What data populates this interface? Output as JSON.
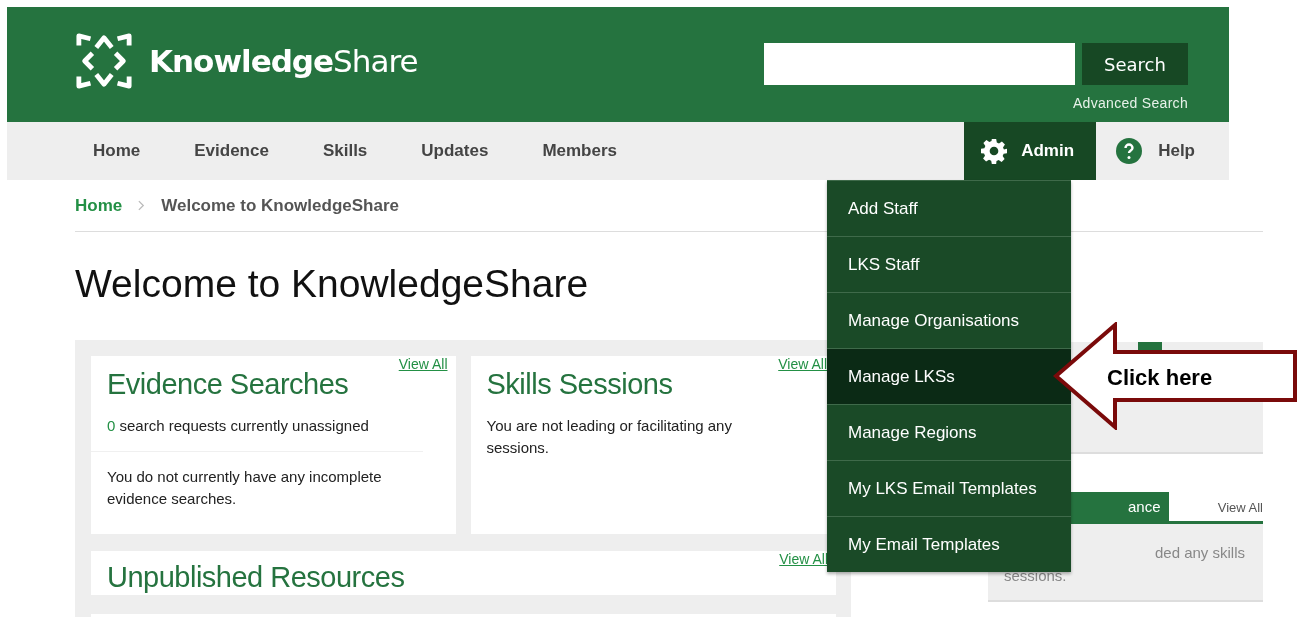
{
  "header": {
    "logo": {
      "bold": "Knowledge",
      "light": "Share"
    },
    "search": {
      "button": "Search",
      "link": "Advanced Search"
    }
  },
  "nav": {
    "items": [
      {
        "label": "Home",
        "kind": "plain",
        "selected": false
      },
      {
        "label": "Evidence",
        "kind": "plain",
        "selected": false
      },
      {
        "label": "Skills",
        "kind": "plain",
        "selected": false
      },
      {
        "label": "Updates",
        "kind": "plain",
        "selected": false
      },
      {
        "label": "Members",
        "kind": "plain",
        "selected": false
      },
      {
        "label": "Admin",
        "kind": "admin",
        "selected": true
      },
      {
        "label": "Help",
        "kind": "help",
        "selected": false
      }
    ]
  },
  "admin_menu": [
    {
      "label": "Add Staff",
      "selected": false
    },
    {
      "label": "LKS Staff",
      "selected": false
    },
    {
      "label": "Manage Organisations",
      "selected": false
    },
    {
      "label": "Manage LKSs",
      "selected": true
    },
    {
      "label": "Manage Regions",
      "selected": false
    },
    {
      "label": "My LKS Email Templates",
      "selected": false
    },
    {
      "label": "My Email Templates",
      "selected": false
    }
  ],
  "breadcrumb": [
    {
      "label": "Home",
      "link": true
    },
    {
      "label": "Welcome to KnowledgeShare",
      "link": false
    }
  ],
  "page_title": "Welcome to KnowledgeShare",
  "cards": [
    {
      "title": "Evidence Searches",
      "view_all": "View All",
      "count": "0",
      "count_text": "search requests currently unassigned",
      "body": "You do not currently have any incomplete evidence searches."
    },
    {
      "title": "Skills Sessions",
      "view_all": "View All",
      "body": "You are not leading or facilitating any sessions."
    },
    {
      "title": "Unpublished Resources",
      "view_all": "View All"
    }
  ],
  "side_panel": {
    "tab": "ance",
    "view_all": "View All",
    "text_line_1": "ded any skills",
    "text_line_2": "sessions."
  },
  "callout": {
    "text": "Click here"
  }
}
